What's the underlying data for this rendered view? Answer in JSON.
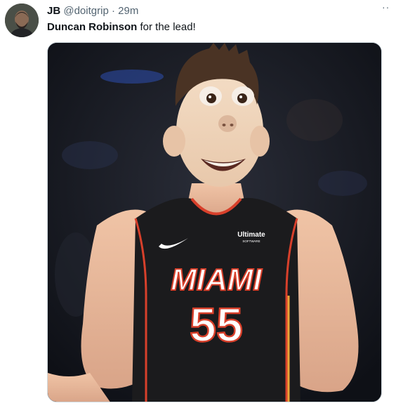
{
  "tweet": {
    "author_name": "JB",
    "author_handle": "@doitgrip",
    "separator": "·",
    "time": "29m",
    "more_label": "··",
    "text_bold": "Duncan Robinson",
    "text_rest": " for the lead!"
  },
  "media": {
    "jersey_city": "MIAMI",
    "jersey_number": "55",
    "sponsor_line1": "Ultimate",
    "sponsor_line2": "SOFTWARE"
  },
  "colors": {
    "name": "#0f1419",
    "secondary": "#536471",
    "jersey": "#1b1b1d",
    "jersey_trim": "#d8402b",
    "skin": "#e7b89b"
  },
  "icons": {
    "more": "more-dots-icon",
    "logo": "swoosh-logo-icon"
  }
}
